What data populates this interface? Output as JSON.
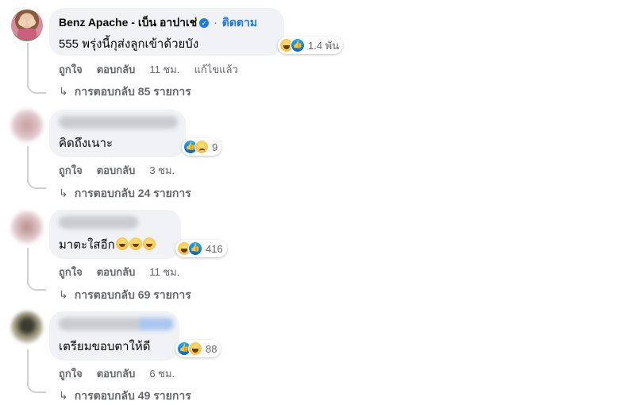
{
  "comments": [
    {
      "author": "Benz Apache - เบ็น อาปาเช่",
      "follow_label": "ติดตาม",
      "separator": "·",
      "text": "555 พรุ่งนี้กุส่งลูกเข้าด้วยบัง",
      "reaction_icons": [
        "haha-icon",
        "like-icon"
      ],
      "reaction_count": "1.4 พัน",
      "like_label": "ถูกใจ",
      "reply_label": "ตอบกลับ",
      "time": "11 ชม.",
      "edited_label": "แก้ไขแล้ว",
      "replies_label": "การตอบกลับ 85 รายการ"
    },
    {
      "author_blurred": true,
      "text": "คิดถึงเนาะ",
      "reaction_icons": [
        "like-icon",
        "sad-icon"
      ],
      "reaction_count": "9",
      "like_label": "ถูกใจ",
      "reply_label": "ตอบกลับ",
      "time": "3 ชม.",
      "replies_label": "การตอบกลับ 24 รายการ"
    },
    {
      "author_blurred": true,
      "text": "มาตะใสอีก",
      "text_emoji": [
        "grin-emoji",
        "grin-emoji",
        "grin-emoji"
      ],
      "reaction_icons": [
        "haha-icon",
        "like-icon"
      ],
      "reaction_count": "416",
      "like_label": "ถูกใจ",
      "reply_label": "ตอบกลับ",
      "time": "11 ชม.",
      "replies_label": "การตอบกลับ 69 รายการ"
    },
    {
      "author_blurred": true,
      "text": "เตรียมขอบตาให้ดี",
      "reaction_icons": [
        "like-icon",
        "haha-icon"
      ],
      "reaction_count": "88",
      "like_label": "ถูกใจ",
      "reply_label": "ตอบกลับ",
      "time": "6 ชม.",
      "replies_label": "การตอบกลับ 49 รายการ"
    }
  ],
  "colors": {
    "link_blue": "#1877f2",
    "bubble_bg": "#f0f2f5",
    "secondary_text": "#65676b",
    "thread_line": "#ced0d4"
  }
}
